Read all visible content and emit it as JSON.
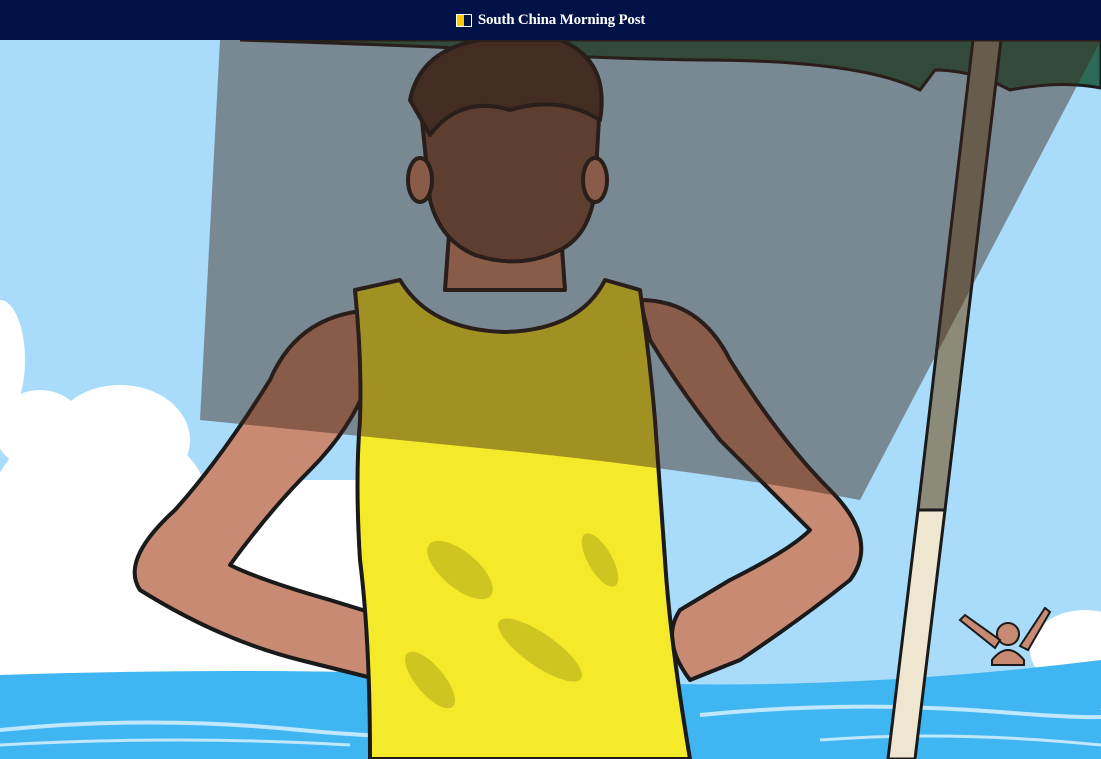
{
  "header": {
    "brand_name": "South China Morning Post",
    "logo_icon": "scmp-logo-icon",
    "background_color": "#001246",
    "accent_color": "#ffca05"
  },
  "illustration": {
    "subject": "man-in-yellow-tank-top-with-tan-lines-at-beach",
    "colors": {
      "sky": "#a9dcfa",
      "sea": "#3fb6f2",
      "tank_top": "#f4ea2a",
      "skin": "#c98a74",
      "umbrella": "#2c6a57"
    }
  }
}
